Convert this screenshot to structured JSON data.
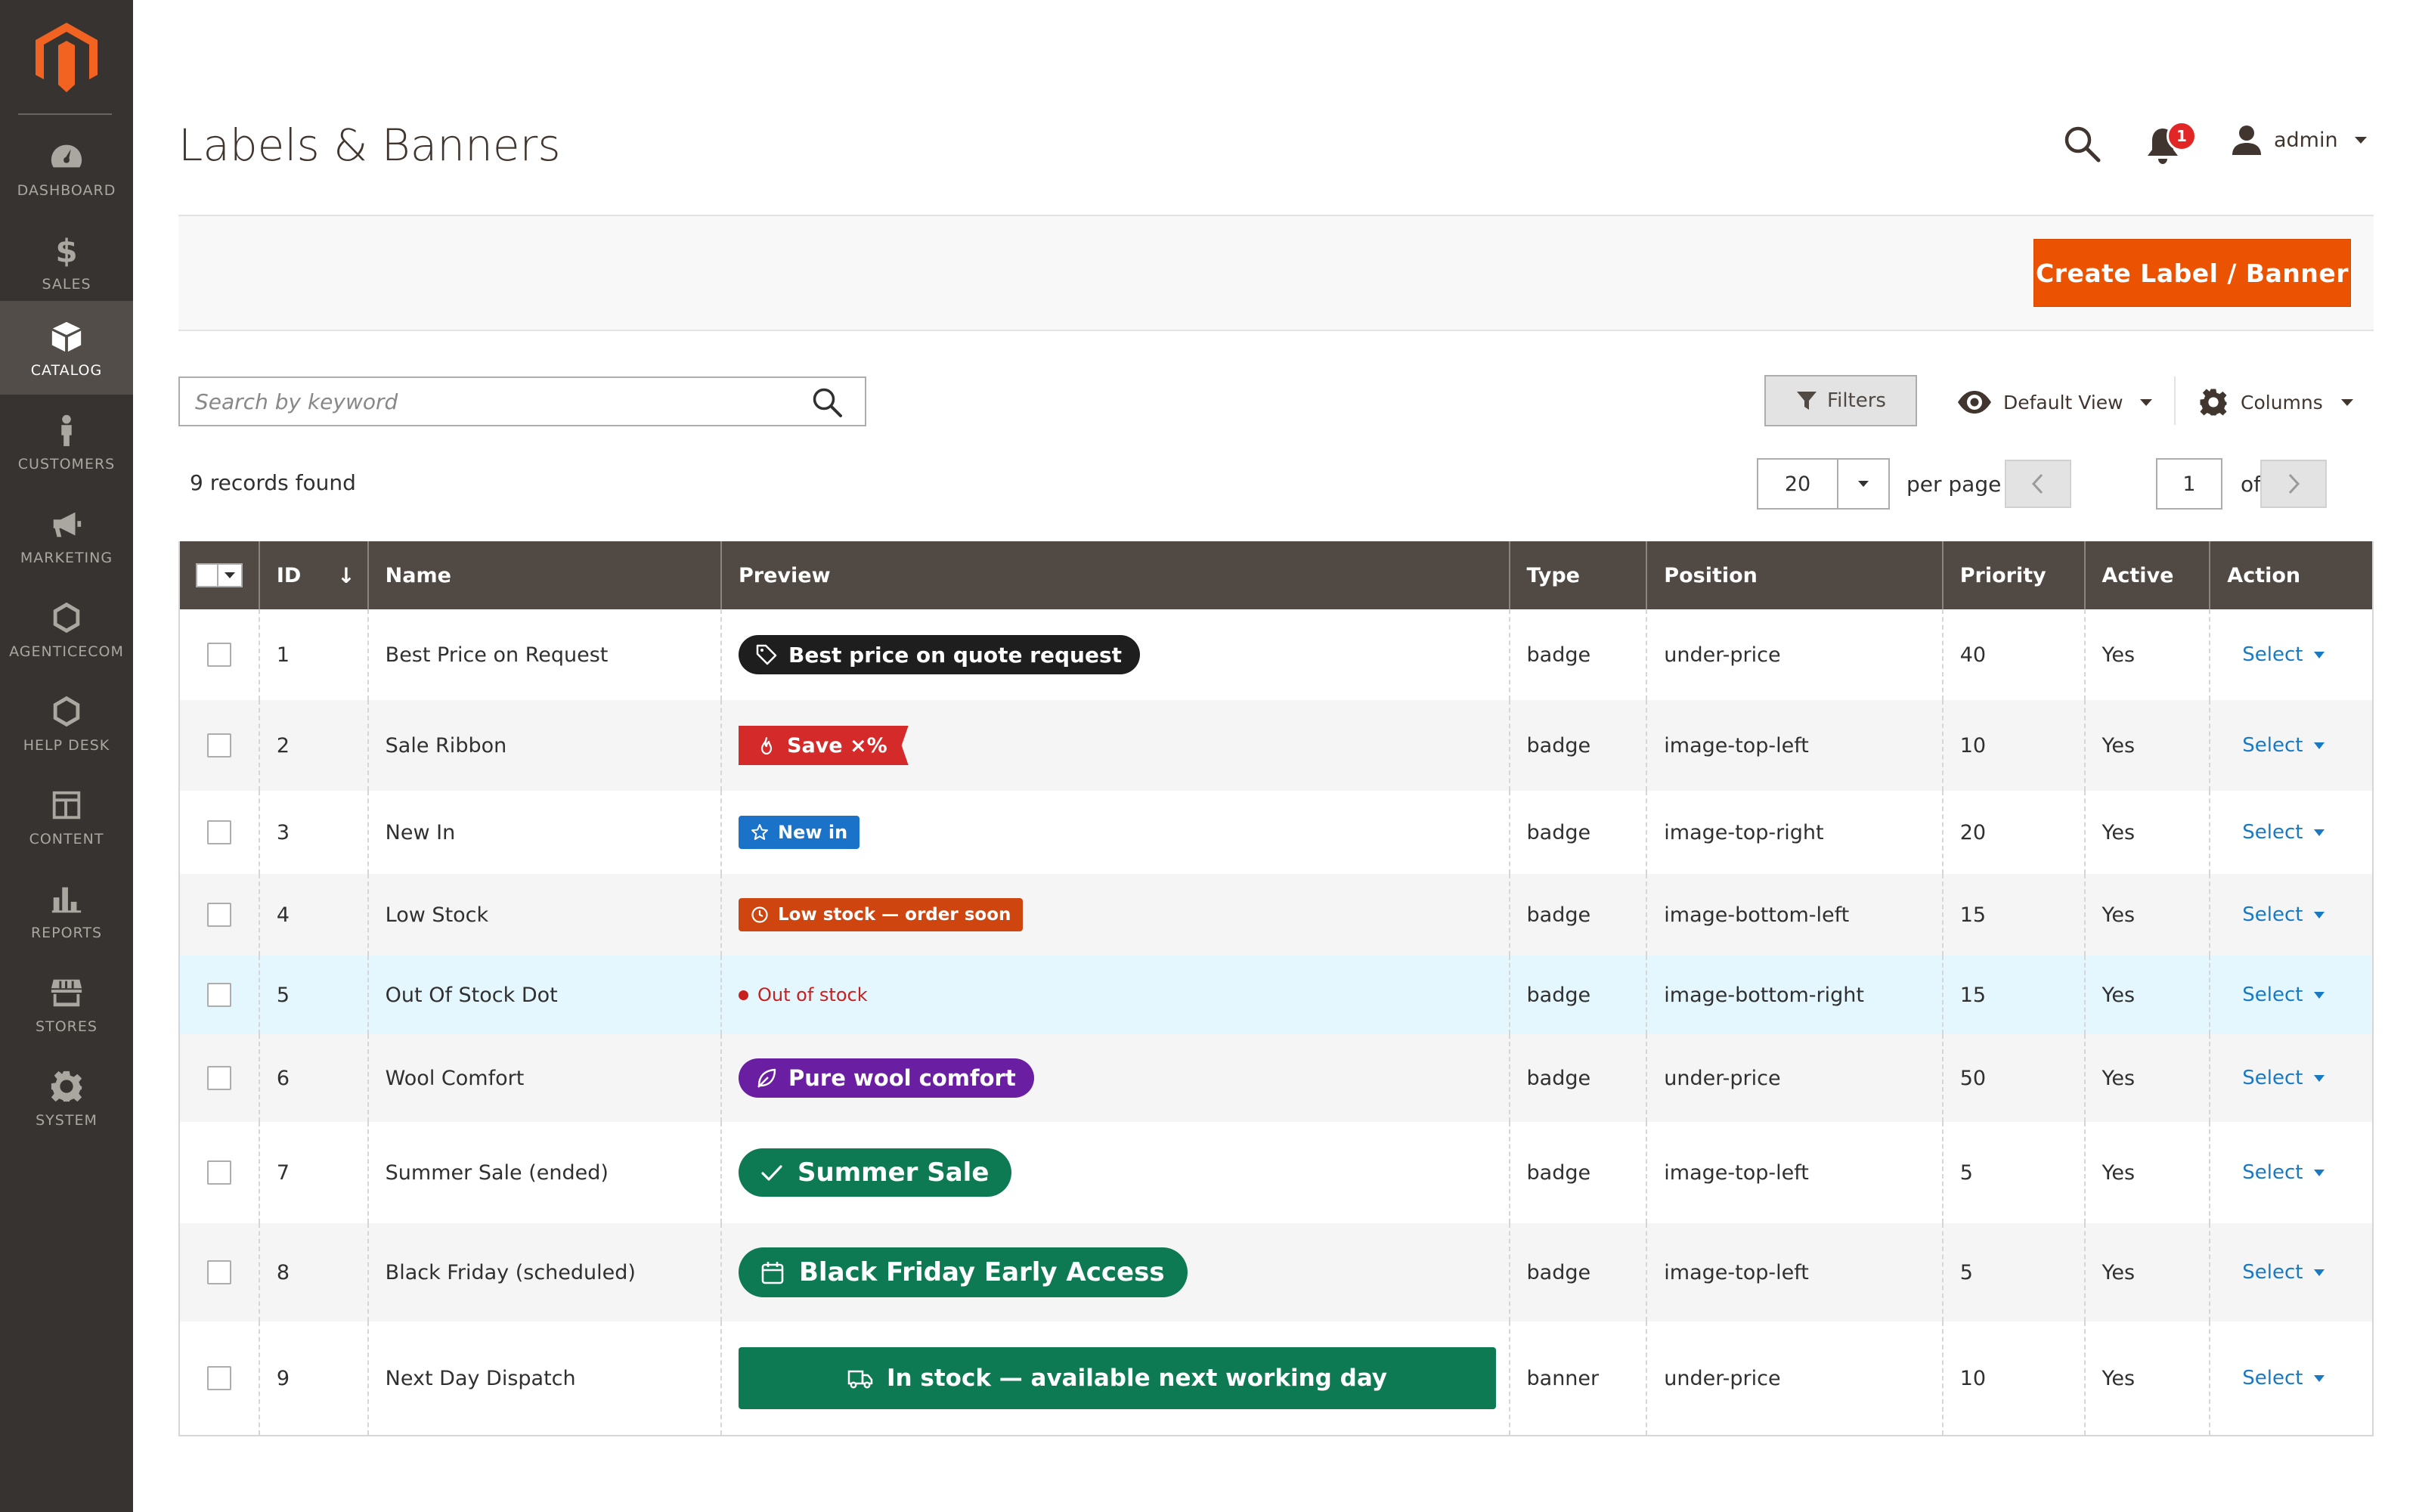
{
  "sidebar": {
    "logo": "magento-logo",
    "items": [
      {
        "label": "DASHBOARD",
        "icon": "dashboard-icon",
        "active": false
      },
      {
        "label": "SALES",
        "icon": "dollar-icon",
        "active": false
      },
      {
        "label": "CATALOG",
        "icon": "box-icon",
        "active": true
      },
      {
        "label": "CUSTOMERS",
        "icon": "person-icon",
        "active": false
      },
      {
        "label": "MARKETING",
        "icon": "megaphone-icon",
        "active": false
      },
      {
        "label": "AGENTICECOM",
        "icon": "hexagon-icon",
        "active": false
      },
      {
        "label": "HELP DESK",
        "icon": "hexagon-icon",
        "active": false
      },
      {
        "label": "CONTENT",
        "icon": "layout-icon",
        "active": false
      },
      {
        "label": "REPORTS",
        "icon": "bar-chart-icon",
        "active": false
      },
      {
        "label": "STORES",
        "icon": "store-icon",
        "active": false
      },
      {
        "label": "SYSTEM",
        "icon": "gear-icon",
        "active": false
      }
    ]
  },
  "header": {
    "title": "Labels & Banners",
    "notification_count": "1",
    "user": "admin"
  },
  "actions": {
    "create_label": "Create Label / Banner"
  },
  "toolbar": {
    "search_placeholder": "Search by keyword",
    "filters_label": "Filters",
    "view_label": "Default View",
    "columns_label": "Columns",
    "records_found": "9 records found",
    "per_page_value": "20",
    "per_page_label": "per page",
    "page_value": "1",
    "page_of": "of 1"
  },
  "table": {
    "columns": [
      "ID",
      "Name",
      "Preview",
      "Type",
      "Position",
      "Priority",
      "Active",
      "Action"
    ],
    "sort_indicator": "↓",
    "rows": [
      {
        "id": "1",
        "name": "Best Price on Request",
        "preview": "Best price on quote request",
        "type": "badge",
        "position": "under-price",
        "priority": "40",
        "active": "Yes",
        "action": "Select"
      },
      {
        "id": "2",
        "name": "Sale Ribbon",
        "preview": "Save ×%",
        "type": "badge",
        "position": "image-top-left",
        "priority": "10",
        "active": "Yes",
        "action": "Select"
      },
      {
        "id": "3",
        "name": "New In",
        "preview": "New in",
        "type": "badge",
        "position": "image-top-right",
        "priority": "20",
        "active": "Yes",
        "action": "Select"
      },
      {
        "id": "4",
        "name": "Low Stock",
        "preview": "Low stock — order soon",
        "type": "badge",
        "position": "image-bottom-left",
        "priority": "15",
        "active": "Yes",
        "action": "Select"
      },
      {
        "id": "5",
        "name": "Out Of Stock Dot",
        "preview": "Out of stock",
        "type": "badge",
        "position": "image-bottom-right",
        "priority": "15",
        "active": "Yes",
        "action": "Select"
      },
      {
        "id": "6",
        "name": "Wool Comfort",
        "preview": "Pure wool comfort",
        "type": "badge",
        "position": "under-price",
        "priority": "50",
        "active": "Yes",
        "action": "Select"
      },
      {
        "id": "7",
        "name": "Summer Sale (ended)",
        "preview": "Summer Sale",
        "type": "badge",
        "position": "image-top-left",
        "priority": "5",
        "active": "Yes",
        "action": "Select"
      },
      {
        "id": "8",
        "name": "Black Friday (scheduled)",
        "preview": "Black Friday Early Access",
        "type": "badge",
        "position": "image-top-left",
        "priority": "5",
        "active": "Yes",
        "action": "Select"
      },
      {
        "id": "9",
        "name": "Next Day Dispatch",
        "preview": "In stock — available next working day",
        "type": "banner",
        "position": "under-price",
        "priority": "10",
        "active": "Yes",
        "action": "Select"
      }
    ]
  },
  "colors": {
    "sidebar_bg": "#373330",
    "accent_orange": "#eb5202",
    "table_header_bg": "#514943",
    "link_blue": "#1979c3"
  }
}
